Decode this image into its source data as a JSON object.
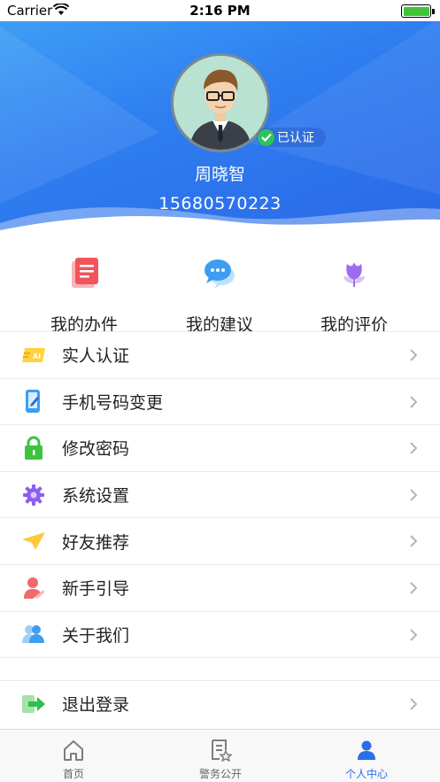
{
  "status_bar": {
    "carrier": "Carrier",
    "time": "2:16 PM"
  },
  "profile": {
    "badge": "已认证",
    "name": "周晓智",
    "phone": "15680570223"
  },
  "quick_actions": [
    {
      "label": "我的办件",
      "icon": "document-icon"
    },
    {
      "label": "我的建议",
      "icon": "chat-bubble-icon"
    },
    {
      "label": "我的评价",
      "icon": "flower-icon"
    }
  ],
  "menu": [
    {
      "label": "实人认证",
      "icon": "id-badge-icon"
    },
    {
      "label": "手机号码变更",
      "icon": "phone-edit-icon"
    },
    {
      "label": "修改密码",
      "icon": "lock-icon"
    },
    {
      "label": "系统设置",
      "icon": "gear-icon"
    },
    {
      "label": "好友推荐",
      "icon": "paper-plane-icon"
    },
    {
      "label": "新手引导",
      "icon": "user-guide-icon"
    },
    {
      "label": "关于我们",
      "icon": "people-icon"
    }
  ],
  "logout": {
    "label": "退出登录",
    "icon": "exit-icon"
  },
  "tabs": [
    {
      "label": "首页",
      "icon": "home-icon",
      "active": false
    },
    {
      "label": "警务公开",
      "icon": "document-star-icon",
      "active": false
    },
    {
      "label": "个人中心",
      "icon": "person-icon",
      "active": true
    }
  ],
  "colors": {
    "accent": "#2a6ee8",
    "header_gradient_start": "#3fa3f5",
    "verified_green": "#2fc25b"
  }
}
